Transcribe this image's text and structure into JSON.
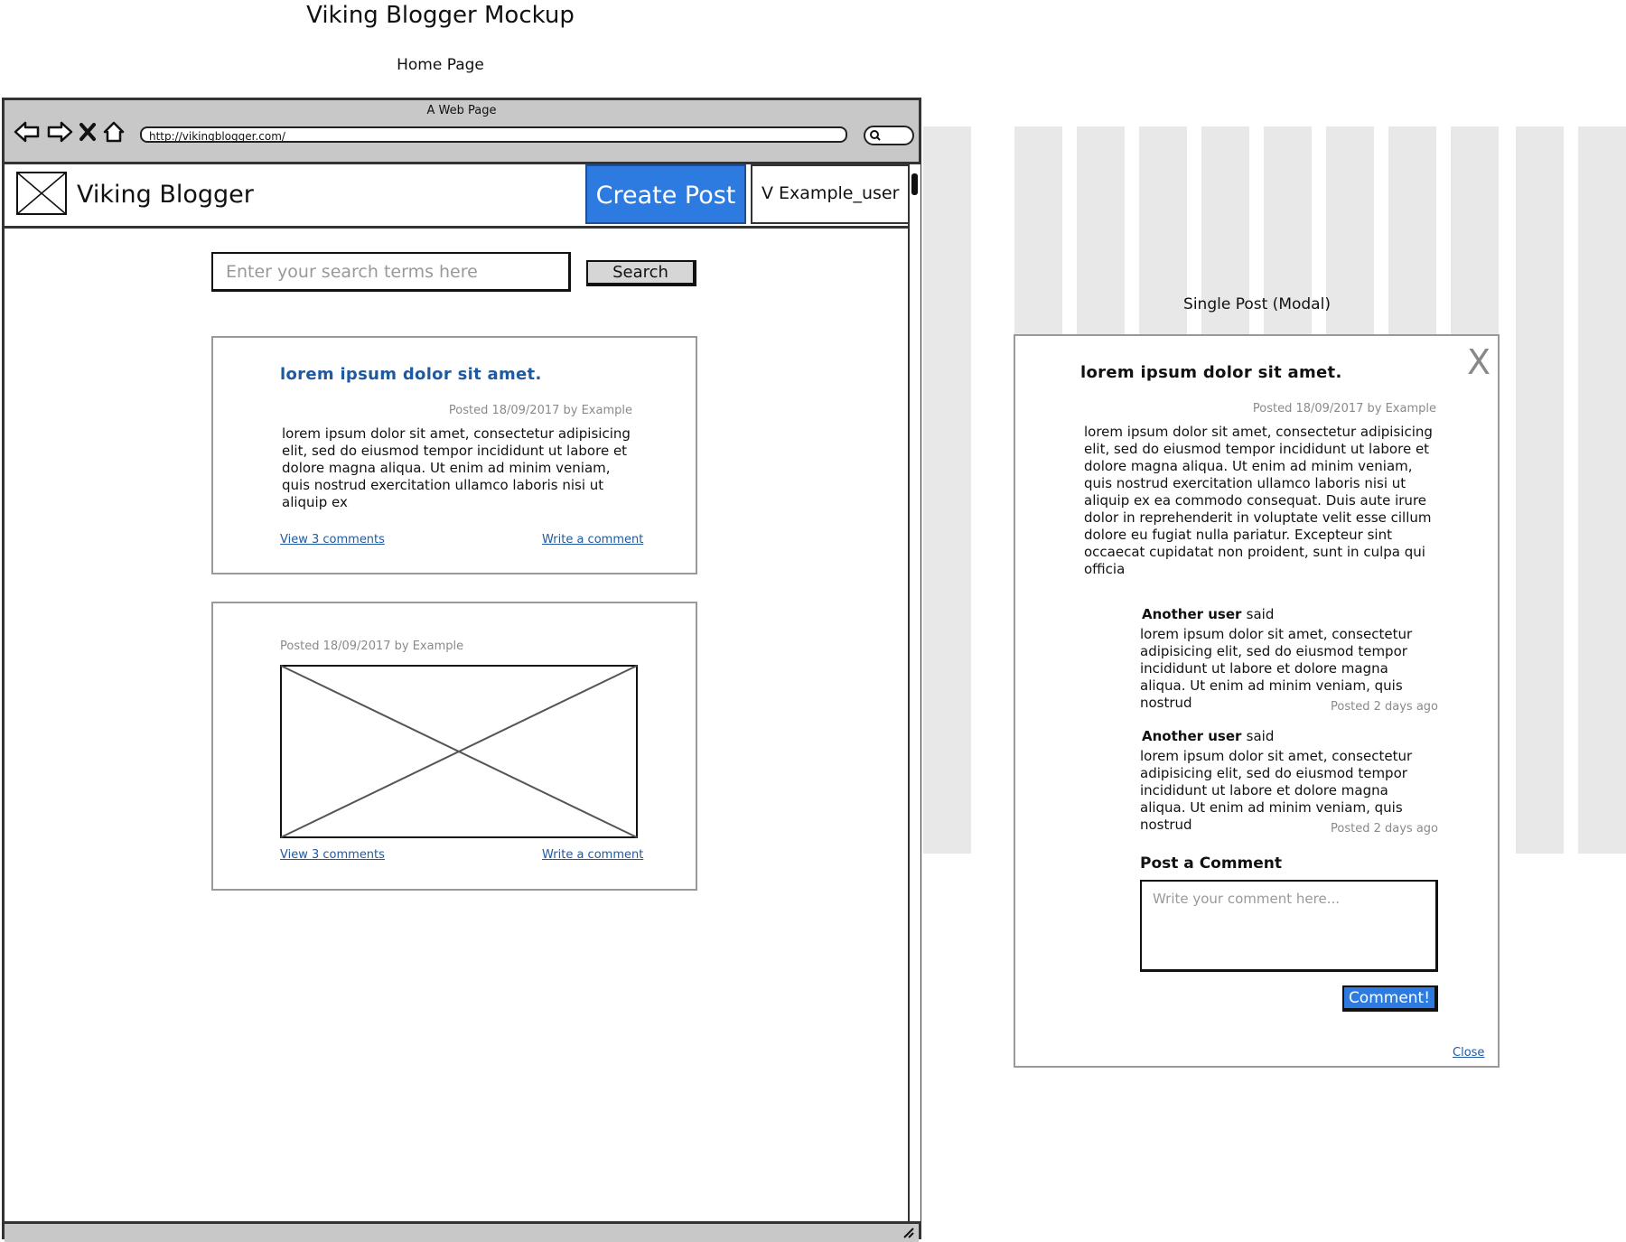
{
  "page": {
    "title": "Viking Blogger Mockup",
    "home_label": "Home Page",
    "modal_label": "Single Post (Modal)"
  },
  "browser": {
    "window_title": "A Web Page",
    "url": "http://vikingblogger.com/"
  },
  "header": {
    "brand": "Viking Blogger",
    "create_post": "Create Post",
    "user_menu": "V Example_user"
  },
  "search": {
    "placeholder": "Enter your search terms here",
    "button": "Search"
  },
  "posts": [
    {
      "title": "lorem ipsum dolor sit amet.",
      "meta": "Posted 18/09/2017 by Example",
      "body": "lorem ipsum dolor sit amet, consectetur adipisicing elit, sed do eiusmod tempor incididunt ut labore et dolore magna aliqua. Ut enim ad minim veniam, quis nostrud exercitation ullamco laboris nisi ut aliquip ex",
      "view_comments": "View 3 comments",
      "write_comment": "Write a comment"
    },
    {
      "meta": "Posted 18/09/2017 by Example",
      "view_comments": "View 3 comments",
      "write_comment": "Write a comment"
    }
  ],
  "modal": {
    "title": "lorem ipsum dolor sit amet.",
    "meta": "Posted 18/09/2017 by Example",
    "close_x": "X",
    "body": "lorem ipsum dolor sit amet, consectetur adipisicing elit, sed do eiusmod tempor incididunt ut labore et dolore magna aliqua. Ut enim ad minim veniam, quis nostrud exercitation ullamco laboris nisi ut aliquip ex ea commodo consequat. Duis aute irure dolor in reprehenderit in voluptate velit esse cillum dolore eu fugiat nulla pariatur. Excepteur sint occaecat cupidatat non proident, sunt in culpa qui officia",
    "comments": [
      {
        "author": "Another user",
        "said": "said",
        "text": "lorem ipsum dolor sit amet, consectetur adipisicing elit, sed do eiusmod tempor incididunt ut labore et dolore magna aliqua. Ut enim ad minim veniam, quis nostrud",
        "time": "Posted 2 days ago"
      },
      {
        "author": "Another user",
        "said": "said",
        "text": "lorem ipsum dolor sit amet, consectetur adipisicing elit, sed do eiusmod tempor incididunt ut labore et dolore magna aliqua. Ut enim ad minim veniam, quis nostrud",
        "time": "Posted 2 days ago"
      }
    ],
    "post_comment_title": "Post a Comment",
    "comment_placeholder": "Write your comment here...",
    "comment_button": "Comment!",
    "close_link": "Close"
  },
  "colors": {
    "accent": "#2d7be0",
    "link": "#1f5aa0",
    "chrome": "#c8c8c8",
    "grid": "#e8e8e8"
  }
}
